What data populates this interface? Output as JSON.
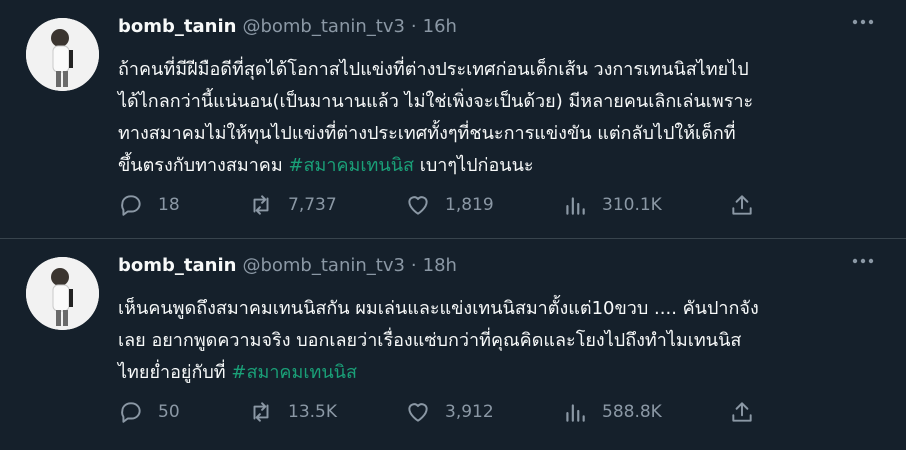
{
  "colors": {
    "background": "#15202b",
    "hashtag": "#1aa078",
    "muted": "#8b98a5",
    "divider": "#38444d"
  },
  "tweets": [
    {
      "name": "bomb_tanin",
      "handle": "@bomb_tanin_tv3",
      "separator": "·",
      "time": "16h",
      "text": "ถ้าคนที่มีฝีมือดีที่สุดได้โอกาสไปแข่งที่ต่างประเทศก่อนเด็กเส้น วงการเทนนิสไทยไป\nได้ไกลกว่านี้แน่นอน(เป็นมานานแล้ว ไม่ใช่เพิ่งจะเป็นด้วย) มีหลายคนเลิกเล่นเพราะ\nทางสมาคมไม่ให้ทุนไปแข่งที่ต่างประเทศทั้งๆที่ชนะการแข่งขัน แต่กลับไปให้เด็กที่\nขึ้นตรงกับทางสมาคม ",
      "hashtag": "#สมาคมเทนนิส",
      "text_after": " เบาๆไปก่อนนะ",
      "replies": "18",
      "retweets": "7,737",
      "likes": "1,819",
      "views": "310.1K",
      "icons": [
        "reply-icon",
        "retweet-icon",
        "like-icon",
        "views-icon",
        "share-icon",
        "more-icon"
      ]
    },
    {
      "name": "bomb_tanin",
      "handle": "@bomb_tanin_tv3",
      "separator": "·",
      "time": "18h",
      "text": "เห็นคนพูดถึงสมาคมเทนนิสกัน ผมเล่นและแข่งเทนนิสมาตั้งแต่10ขวบ .... คันปากจัง\nเลย อยากพูดความจริง บอกเลยว่าเรื่องแซ่บกว่าที่คุณคิดและโยงไปถึงทำไมเทนนิส\nไทยย่ำอยู่กับที่ ",
      "hashtag": "#สมาคมเทนนิส",
      "text_after": "",
      "replies": "50",
      "retweets": "13.5K",
      "likes": "3,912",
      "views": "588.8K",
      "icons": [
        "reply-icon",
        "retweet-icon",
        "like-icon",
        "views-icon",
        "share-icon",
        "more-icon"
      ]
    }
  ]
}
